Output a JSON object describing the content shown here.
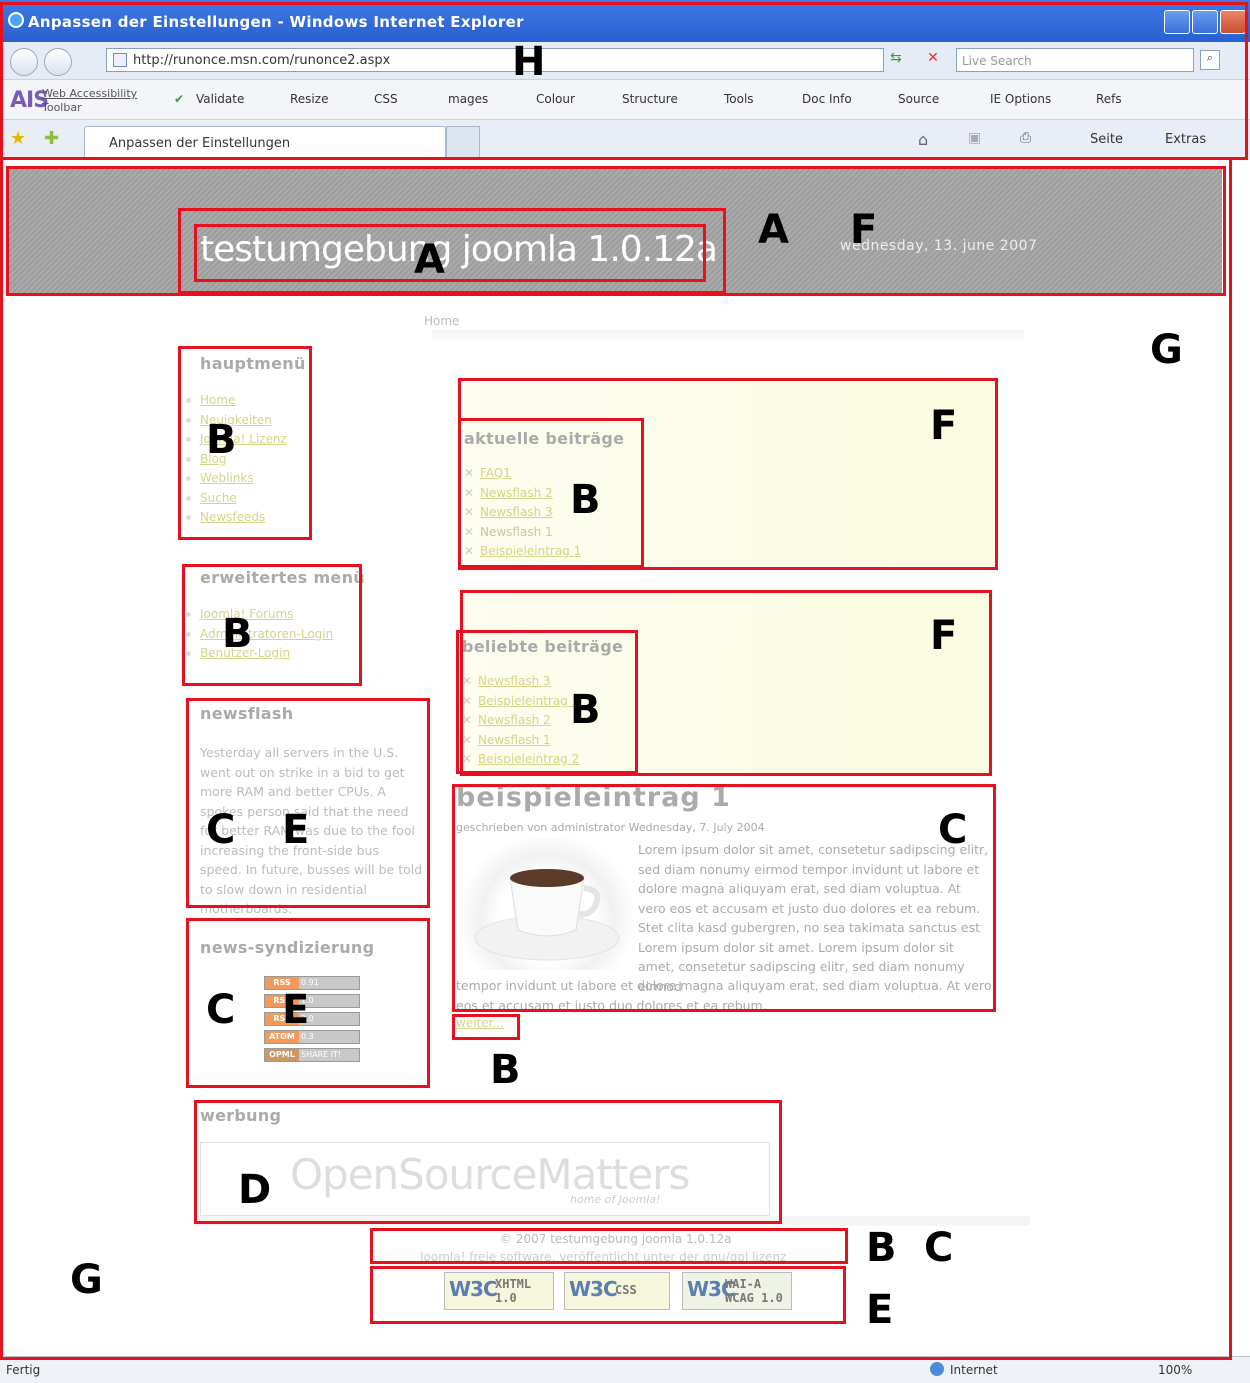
{
  "window": {
    "title": "Anpassen der Einstellungen - Windows Internet Explorer"
  },
  "address": {
    "url": "http://runonce.msn.com/runonce2.aspx",
    "search_placeholder": "Live Search"
  },
  "toolbar": {
    "ais_logo": "AIS",
    "ais_name": "Web Accessibility",
    "ais_sub": "Toolbar",
    "items": [
      "Validate",
      "Resize",
      "CSS",
      "mages",
      "Colour",
      "Structure",
      "Tools",
      "Doc Info",
      "Source",
      "IE Options",
      "Refs"
    ]
  },
  "tabs": {
    "active": "Anpassen der Einstellungen",
    "seite": "Seite",
    "extras": "Extras"
  },
  "site": {
    "title": "testumgebung joomla 1.0.12a",
    "date": "wednesday, 13. june 2007",
    "breadcrumb": "Home"
  },
  "hauptmenu": {
    "title": "hauptmenü",
    "items": [
      "Home",
      "Neuigkeiten",
      "Joomla! Lizenz",
      "Blog",
      "Weblinks",
      "Suche",
      "Newsfeeds"
    ]
  },
  "erweitert": {
    "title": "erweitertes menü",
    "items": [
      "Joomla! Forums",
      "Administratoren-Login",
      "Benutzer-Login"
    ]
  },
  "newsflash": {
    "title": "newsflash",
    "text": "Yesterday all servers in the U.S. went out on strike in a bid to get more RAM and better CPUs. A spokes person said that the need for better RAM was due to the fool increasing the front-side bus speed. In future, busses will be told to slow down in residential motherboards."
  },
  "syndication": {
    "title": "news-syndizierung",
    "feeds": [
      {
        "left": "RSS",
        "right": "0.91"
      },
      {
        "left": "RSS",
        "right": "1.0"
      },
      {
        "left": "RSS",
        "right": "2.0"
      },
      {
        "left": "ATOM",
        "right": "0.3"
      },
      {
        "left": "OPML",
        "right": "SHARE IT!"
      }
    ]
  },
  "aktuelle": {
    "title": "aktuelle beiträge",
    "items": [
      "FAQ1",
      "Newsflash 2",
      "Newsflash 3",
      "Newsflash 1",
      "Beispieleintrag 1"
    ]
  },
  "beliebte": {
    "title": "beliebte beiträge",
    "items": [
      "Newsflash 3",
      "Beispieleintrag 1",
      "Newsflash 2",
      "Newsflash 1",
      "Beispieleintrag 2"
    ]
  },
  "article": {
    "title": "beispieleintrag 1",
    "meta": "geschrieben von administrator Wednesday, 7. July 2004",
    "body": "Lorem ipsum dolor sit amet, consetetur sadipscing elitr, sed diam nonumy eirmod tempor invidunt ut labore et dolore magna aliquyam erat, sed diam voluptua. At vero eos et accusam et justo duo dolores et ea rebum. Stet clita kasd gubergren, no sea takimata sanctus est Lorem ipsum dolor sit amet. Lorem ipsum dolor sit amet, consetetur sadipscing elitr, sed diam nonumy eirmod",
    "body2": "tempor invidunt ut labore et dolore magna aliquyam erat, sed diam voluptua. At vero eos et accusam et justo duo dolores et ea rebum.",
    "more": "weiter..."
  },
  "werbung": {
    "title": "werbung",
    "logo": "OpenSourceMatters",
    "tagline": "home of Joomla!"
  },
  "footer": {
    "copyright": "© 2007 testumgebung joomla 1.0.12a",
    "license": "Joomla! freie software, veröffentlicht unter der gnu/gpl lizenz"
  },
  "badges": [
    {
      "brand": "W3C",
      "text1": "XHTML",
      "text2": "1.0"
    },
    {
      "brand": "W3C",
      "text1": "CSS",
      "text2": ""
    },
    {
      "brand": "W3C",
      "text1": "WAI-A",
      "text2": "WCAG 1.0"
    }
  ],
  "status": {
    "left": "Fertig",
    "zone": "Internet",
    "zoom": "100%"
  },
  "annotations": {
    "A": "A",
    "B": "B",
    "C": "C",
    "D": "D",
    "E": "E",
    "F": "F",
    "G": "G",
    "H": "H"
  }
}
